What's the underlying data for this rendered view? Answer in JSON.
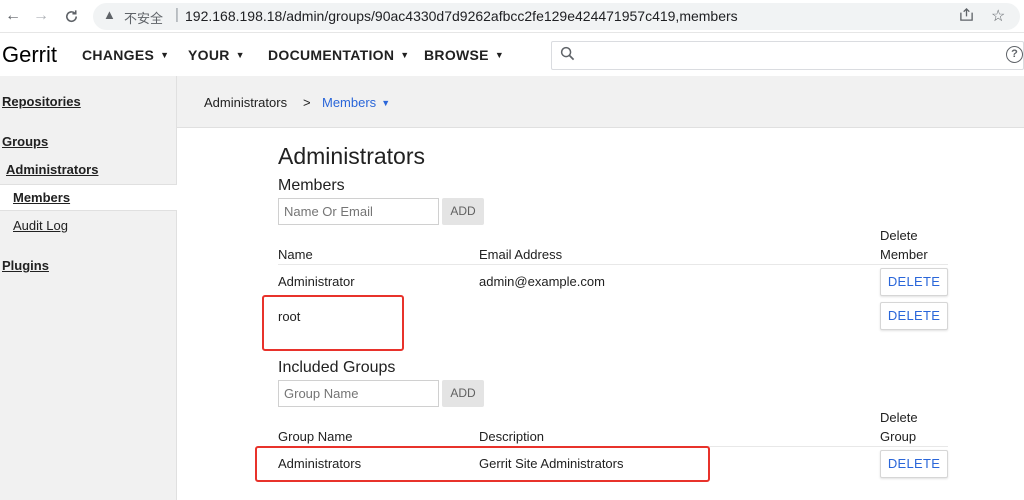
{
  "browser": {
    "back": "←",
    "forward": "→",
    "reload": "C",
    "warning_icon": "▲",
    "insecure_label": "不安全",
    "separator": "|",
    "url": "192.168.198.18/admin/groups/90ac4330d7d9262afbcc2fe129e424471957c419,members"
  },
  "header": {
    "logo": "Gerrit",
    "menus": [
      "CHANGES",
      "YOUR",
      "DOCUMENTATION",
      "BROWSE"
    ],
    "help_icon": "?"
  },
  "sidebar": {
    "repositories": "Repositories",
    "groups": "Groups",
    "group_name": "Administrators",
    "members": "Members",
    "audit_log": "Audit Log",
    "plugins": "Plugins"
  },
  "breadcrumb": {
    "group": "Administrators",
    "separator": ">",
    "current": "Members"
  },
  "main": {
    "title": "Administrators",
    "members_section": {
      "title": "Members",
      "input_placeholder": "Name Or Email",
      "add_label": "ADD",
      "columns": {
        "name": "Name",
        "email": "Email Address",
        "delete_line1": "Delete",
        "delete_line2": "Member"
      },
      "rows": [
        {
          "name": "Administrator",
          "email": "admin@example.com",
          "action": "DELETE"
        },
        {
          "name": "root",
          "email": "",
          "action": "DELETE"
        }
      ]
    },
    "included_groups_section": {
      "title": "Included Groups",
      "input_placeholder": "Group Name",
      "add_label": "ADD",
      "columns": {
        "group_name": "Group Name",
        "description": "Description",
        "delete_line1": "Delete",
        "delete_line2": "Group"
      },
      "rows": [
        {
          "group_name": "Administrators",
          "description": "Gerrit Site Administrators",
          "action": "DELETE"
        }
      ]
    }
  },
  "colors": {
    "link_blue": "#2a66d9",
    "annotation_red": "#e8322b",
    "sidebar_bg": "#f1f1f1"
  }
}
